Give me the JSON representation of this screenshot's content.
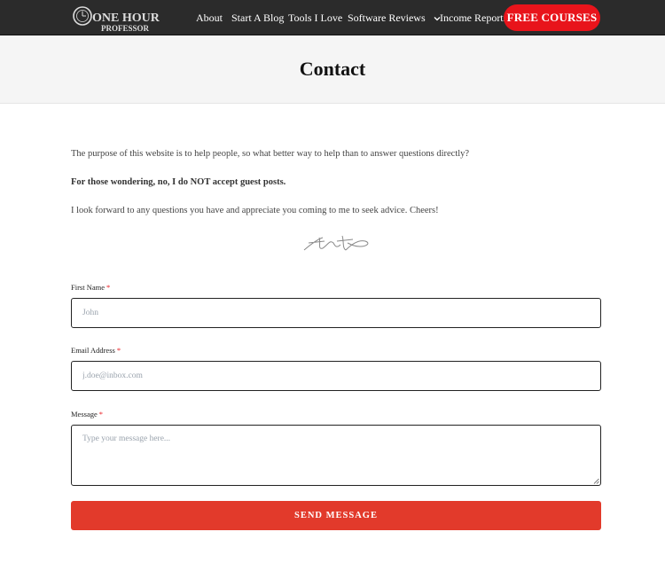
{
  "header": {
    "logo_text_top": "ONE HOUR",
    "logo_text_bottom": "PROFESSOR",
    "nav": {
      "about": "About",
      "start_blog": "Start A Blog",
      "tools": "Tools I Love",
      "software_reviews": "Software Reviews",
      "income_reports": "Income Reports"
    },
    "cta_label": "FREE COURSES",
    "cta_color": "#e8141b",
    "bar_color": "#2b2b2b"
  },
  "page": {
    "title": "Contact"
  },
  "content": {
    "p1": "The purpose of this website is to help people, so what better way to help than to answer questions directly?",
    "p2": "For those wondering, no, I do NOT accept guest posts.",
    "p3": "I look forward to any questions you have and appreciate you coming to me to seek advice. Cheers!"
  },
  "form": {
    "first_name": {
      "label": "First Name",
      "required_mark": "*",
      "placeholder": "John",
      "value": ""
    },
    "email": {
      "label": "Email Address",
      "required_mark": "*",
      "placeholder": "j.doe@inbox.com",
      "value": ""
    },
    "message": {
      "label": "Message",
      "required_mark": "*",
      "placeholder": "Type your message here...",
      "value": ""
    },
    "submit_label": "SEND MESSAGE",
    "submit_color": "#e23a2b"
  }
}
